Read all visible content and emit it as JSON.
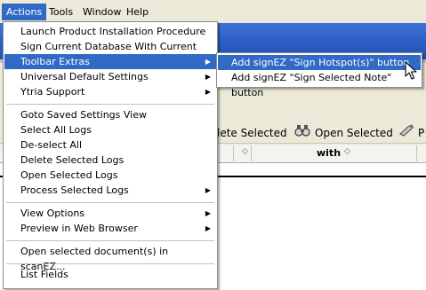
{
  "menubar": {
    "items": [
      {
        "label": "Actions"
      },
      {
        "label": "Tools"
      },
      {
        "label": "Window"
      },
      {
        "label": "Help"
      }
    ]
  },
  "toolbar": {
    "delete_selected": "lete Selected",
    "open_selected": "Open Selected",
    "partial": "P"
  },
  "table": {
    "columns": [
      {
        "label": "",
        "sort_icon": "◇"
      },
      {
        "label": "with",
        "sort_icon": "◇"
      }
    ]
  },
  "actions_menu": {
    "items": [
      {
        "label": "Launch Product Installation Procedure"
      },
      {
        "label": "Sign Current Database With Current User"
      },
      {
        "label": "Toolbar Extras",
        "submenu": true
      },
      {
        "label": "Universal Default Settings",
        "submenu": true
      },
      {
        "label": "Ytria Support",
        "submenu": true
      },
      {
        "label": "Goto Saved Settings View"
      },
      {
        "label": "Select All Logs"
      },
      {
        "label": "De-select All"
      },
      {
        "label": "Delete Selected Logs"
      },
      {
        "label": "Open Selected Logs"
      },
      {
        "label": "Process Selected Logs",
        "submenu": true
      },
      {
        "label": "View Options",
        "submenu": true
      },
      {
        "label": "Preview in Web Browser",
        "submenu": true
      },
      {
        "label": "Open selected document(s) in scanEZ..."
      },
      {
        "label": "List Fields"
      }
    ],
    "highlighted": "Toolbar Extras",
    "submenu_arrow": "▶"
  },
  "toolbar_extras_submenu": {
    "items": [
      {
        "label": "Add signEZ \"Sign Hotspot(s)\" button"
      },
      {
        "label": "Add signEZ \"Sign Selected Note\" button"
      }
    ],
    "highlighted": "Add signEZ \"Sign Hotspot(s)\" button"
  },
  "colors": {
    "highlight": "#316ac5",
    "menubar_bg": "#ece9d8",
    "app_band": "#2a5bc0"
  }
}
